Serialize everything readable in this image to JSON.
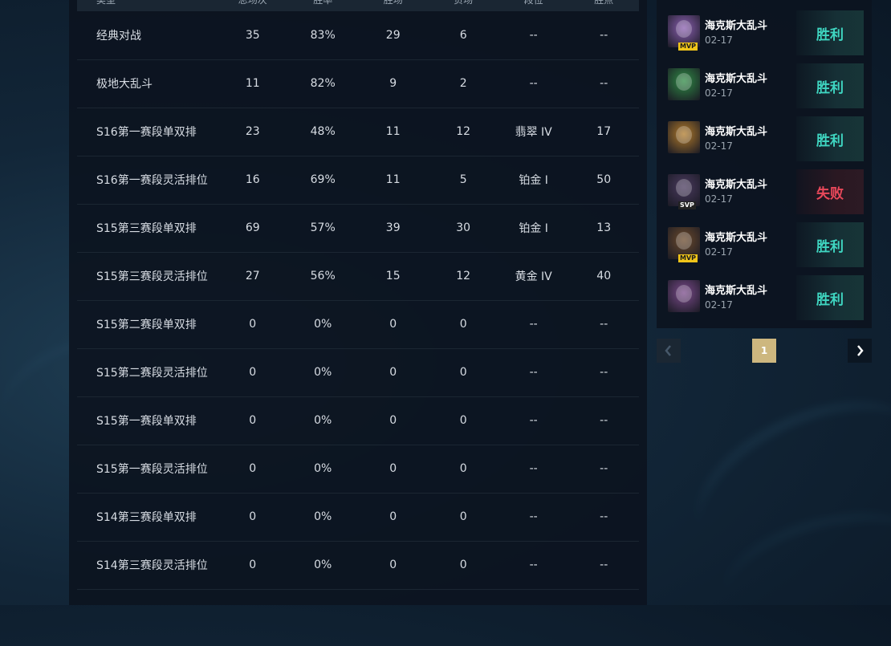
{
  "stats": {
    "headers": [
      "类型",
      "总场次",
      "胜率",
      "胜场",
      "负场",
      "段位",
      "胜点"
    ],
    "rows": [
      [
        "经典对战",
        "35",
        "83%",
        "29",
        "6",
        "--",
        "--"
      ],
      [
        "极地大乱斗",
        "11",
        "82%",
        "9",
        "2",
        "--",
        "--"
      ],
      [
        "S16第一赛段单双排",
        "23",
        "48%",
        "11",
        "12",
        "翡翠 IV",
        "17"
      ],
      [
        "S16第一赛段灵活排位",
        "16",
        "69%",
        "11",
        "5",
        "铂金 I",
        "50"
      ],
      [
        "S15第三赛段单双排",
        "69",
        "57%",
        "39",
        "30",
        "铂金 I",
        "13"
      ],
      [
        "S15第三赛段灵活排位",
        "27",
        "56%",
        "15",
        "12",
        "黄金 IV",
        "40"
      ],
      [
        "S15第二赛段单双排",
        "0",
        "0%",
        "0",
        "0",
        "--",
        "--"
      ],
      [
        "S15第二赛段灵活排位",
        "0",
        "0%",
        "0",
        "0",
        "--",
        "--"
      ],
      [
        "S15第一赛段单双排",
        "0",
        "0%",
        "0",
        "0",
        "--",
        "--"
      ],
      [
        "S15第一赛段灵活排位",
        "0",
        "0%",
        "0",
        "0",
        "--",
        "--"
      ],
      [
        "S14第三赛段单双排",
        "0",
        "0%",
        "0",
        "0",
        "--",
        "--"
      ],
      [
        "S14第三赛段灵活排位",
        "0",
        "0%",
        "0",
        "0",
        "--",
        "--"
      ]
    ]
  },
  "matches": [
    {
      "mode": "海克斯大乱斗",
      "date": "02-17",
      "result": "胜利",
      "outcome": "win",
      "badge": "MVP",
      "icon": "champion-portrait-purple-yordle",
      "icon_color": "#8a5fb0",
      "badge_bg": "#f0c419",
      "badge_fg": "#1a1a1a"
    },
    {
      "mode": "海克斯大乱斗",
      "date": "02-17",
      "result": "胜利",
      "outcome": "win",
      "badge": "",
      "icon": "champion-portrait-green-creature",
      "icon_color": "#2f8a45"
    },
    {
      "mode": "海克斯大乱斗",
      "date": "02-17",
      "result": "胜利",
      "outcome": "win",
      "badge": "",
      "icon": "champion-portrait-golden-armor",
      "icon_color": "#b07a2a"
    },
    {
      "mode": "海克斯大乱斗",
      "date": "02-17",
      "result": "失败",
      "outcome": "loss",
      "badge": "SVP",
      "icon": "champion-portrait-dark-purple",
      "icon_color": "#4a3a5e",
      "badge_bg": "#222222",
      "badge_fg": "#ffffff"
    },
    {
      "mode": "海克斯大乱斗",
      "date": "02-17",
      "result": "胜利",
      "outcome": "win",
      "badge": "MVP",
      "icon": "champion-portrait-brown-warrior",
      "icon_color": "#6b4a2c",
      "badge_bg": "#f0c419",
      "badge_fg": "#1a1a1a"
    },
    {
      "mode": "海克斯大乱斗",
      "date": "02-17",
      "result": "胜利",
      "outcome": "win",
      "badge": "",
      "icon": "champion-portrait-purple-witch",
      "icon_color": "#7a4a8a"
    }
  ],
  "pagination": {
    "current": "1",
    "prev_icon": "chevron-left-icon",
    "next_icon": "chevron-right-icon"
  },
  "colors": {
    "win": "#3fd6c1",
    "loss": "#e8485a",
    "page_active": "#cdb77f"
  }
}
